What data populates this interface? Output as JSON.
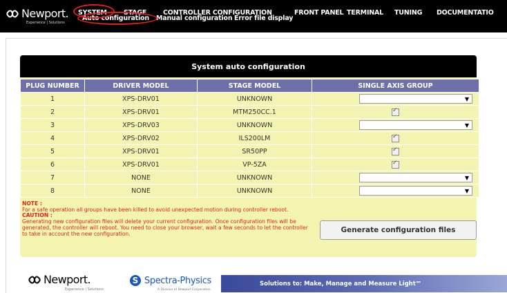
{
  "header": {
    "brand": "Newport.",
    "tagline": "Experience | Solutions",
    "nav": [
      "SYSTEM",
      "STAGE",
      "CONTROLLER CONFIGURATION",
      "FRONT PANEL",
      "TERMINAL",
      "TUNING",
      "DOCUMENTATIO"
    ],
    "subnav": [
      "Auto configuration",
      "Manual configuration",
      "Error file display"
    ]
  },
  "panel": {
    "title": "System auto configuration",
    "columns": [
      "PLUG NUMBER",
      "DRIVER MODEL",
      "STAGE MODEL",
      "SINGLE AXIS GROUP"
    ],
    "rows": [
      {
        "plug": "1",
        "driver": "XPS-DRV01",
        "stage": "UNKNOWN",
        "group": "select"
      },
      {
        "plug": "2",
        "driver": "XPS-DRV01",
        "stage": "MTM250CC.1",
        "group": "checkbox"
      },
      {
        "plug": "3",
        "driver": "XPS-DRV03",
        "stage": "UNKNOWN",
        "group": "select"
      },
      {
        "plug": "4",
        "driver": "XPS-DRV02",
        "stage": "ILS200LM",
        "group": "checkbox"
      },
      {
        "plug": "5",
        "driver": "XPS-DRV01",
        "stage": "SR50PP",
        "group": "checkbox"
      },
      {
        "plug": "6",
        "driver": "XPS-DRV01",
        "stage": "VP-5ZA",
        "group": "checkbox"
      },
      {
        "plug": "7",
        "driver": "NONE",
        "stage": "UNKNOWN",
        "group": "select"
      },
      {
        "plug": "8",
        "driver": "NONE",
        "stage": "UNKNOWN",
        "group": "select"
      }
    ],
    "note_head": "NOTE :",
    "note_text": "For a safe operation all groups have been killed to avoid unexpected motion during controller reboot.",
    "caution_head": "CAUTION :",
    "caution_text": "Generating new configuration files will delete your current configuration. Once configuration files will be generated, the controller will reboot. You need to close your browser, wait a few seconds to let the controller to take in account the new configuration.",
    "generate_button": "Generate configuration files"
  },
  "footer": {
    "brand": "Newport.",
    "brand_tagline": "Experience | Solutions",
    "spectra_name": "Spectra-Physics",
    "spectra_tagline": "A Division of Newport Corporation",
    "banner_text": "Solutions to: Make, Manage and Measure Light℠"
  },
  "colors": {
    "header_bg": "#000000",
    "panel_bg": "#f4f4b2",
    "table_header_bg": "#6e6ea8",
    "highlight_red": "#e0201a",
    "notes_red": "#e0201a"
  }
}
